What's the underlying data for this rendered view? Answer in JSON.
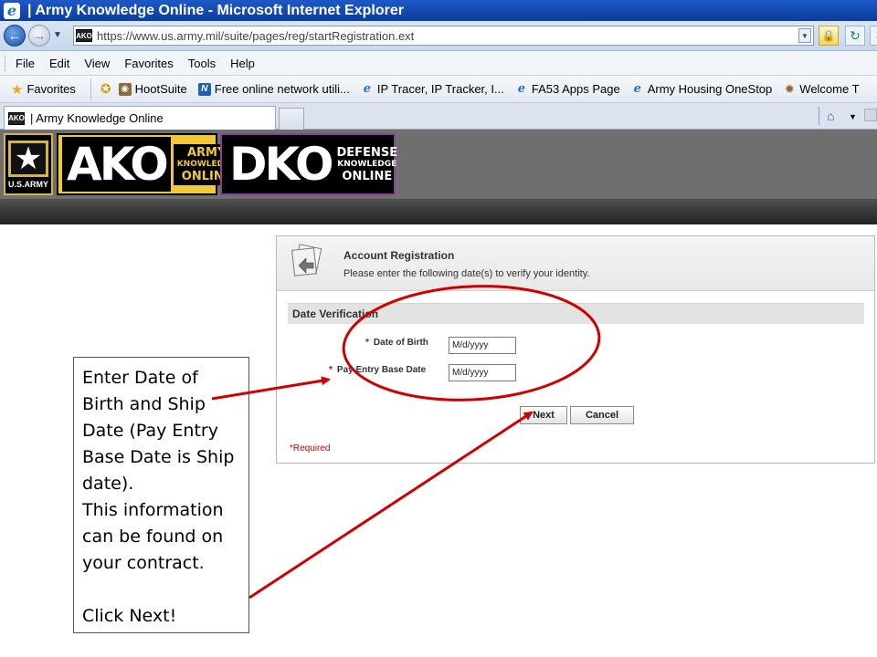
{
  "window": {
    "title": "| Army Knowledge Online - Microsoft Internet Explorer"
  },
  "address": {
    "url": "https://www.us.army.mil/suite/pages/reg/startRegistration.ext",
    "site_icon_text": "AKO"
  },
  "menu": [
    "File",
    "Edit",
    "View",
    "Favorites",
    "Tools",
    "Help"
  ],
  "favorites_bar": {
    "favorites_label": "Favorites",
    "links": [
      {
        "label": "HootSuite",
        "icon": "owl-icon"
      },
      {
        "label": "Free online network utili...",
        "icon": "network-icon"
      },
      {
        "label": "IP Tracer, IP Tracker, I...",
        "icon": "ie-icon"
      },
      {
        "label": "FA53 Apps Page",
        "icon": "ie-icon"
      },
      {
        "label": "Army Housing OneStop",
        "icon": "ie-icon"
      },
      {
        "label": "Welcome T",
        "icon": "gear-icon"
      }
    ]
  },
  "tab": {
    "label": "| Army Knowledge Online"
  },
  "logos": {
    "usarmy_text": "U.S.ARMY",
    "ako_big": "AKO",
    "ako_small": [
      "ARMY",
      "KNOWLEDGE",
      "ONLINE"
    ],
    "dko_big": "DKO",
    "dko_small": [
      "DEFENSE",
      "KNOWLEDGE",
      "ONLINE"
    ]
  },
  "registration": {
    "title": "Account Registration",
    "subtitle": "Please enter the following date(s) to verify your identity.",
    "section": "Date Verification",
    "required_marker": "*",
    "dob_label": "Date of Birth",
    "dob_placeholder": "M/d/yyyy",
    "pebd_label": "Pay Entry Base Date",
    "pebd_placeholder": "M/d/yyyy",
    "next_label": "Next",
    "cancel_label": "Cancel",
    "required_note": "*Required"
  },
  "annotation": {
    "lines": [
      "Enter Date of Birth and Ship Date (Pay Entry Base Date is Ship date).",
      "This information can be found on your contract."
    ],
    "cta": "Click Next!"
  },
  "colors": {
    "annotation_red": "#d00000",
    "titlebar_blue": "#0a3d9e",
    "ako_gold": "#f0c838",
    "dko_purple": "#8a3f9b"
  }
}
